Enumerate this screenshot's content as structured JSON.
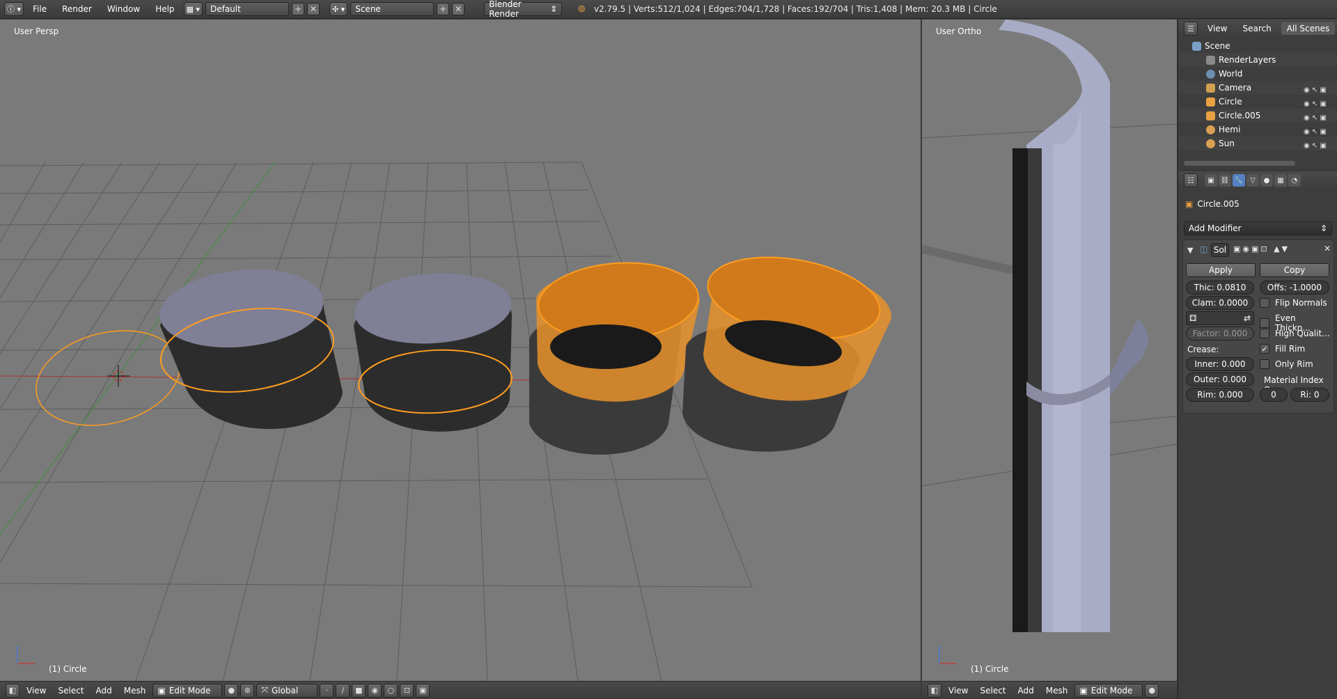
{
  "topbar": {
    "menus": [
      "File",
      "Render",
      "Window",
      "Help"
    ],
    "layout": "Default",
    "scene": "Scene",
    "engine": "Blender Render",
    "stats": "v2.79.5 | Verts:512/1,024 | Edges:704/1,728 | Faces:192/704 | Tris:1,408 | Mem: 20.3 MB | Circle"
  },
  "left_view": {
    "label": "User Persp",
    "footer": "(1) Circle",
    "header": {
      "menus": [
        "View",
        "Select",
        "Add",
        "Mesh"
      ],
      "mode": "Edit Mode",
      "orientation": "Global"
    }
  },
  "right_view": {
    "label": "User Ortho",
    "footer": "(1) Circle",
    "header": {
      "menus": [
        "View",
        "Select",
        "Add",
        "Mesh"
      ],
      "mode": "Edit Mode"
    }
  },
  "outliner": {
    "tabs": [
      "View",
      "Search",
      "All Scenes"
    ],
    "items": [
      {
        "label": "Scene",
        "icon": "scene-icon",
        "color": "#7aa0c8"
      },
      {
        "label": "RenderLayers",
        "icon": "render-layers-icon",
        "color": "#8a8a8a"
      },
      {
        "label": "World",
        "icon": "world-icon",
        "color": "#6b8fb0"
      },
      {
        "label": "Camera",
        "icon": "camera-icon",
        "color": "#d0a050"
      },
      {
        "label": "Circle",
        "icon": "mesh-icon",
        "color": "#e8a040"
      },
      {
        "label": "Circle.005",
        "icon": "mesh-icon",
        "color": "#e8a040"
      },
      {
        "label": "Hemi",
        "icon": "lamp-icon",
        "color": "#d8a050"
      },
      {
        "label": "Sun",
        "icon": "lamp-icon",
        "color": "#d8a050"
      }
    ]
  },
  "properties": {
    "object_name": "Circle.005",
    "add_modifier": "Add Modifier",
    "modifier_name": "Sol",
    "apply": "Apply",
    "copy": "Copy",
    "thickness": "Thic: 0.0810",
    "offset": "Offs: -1.0000",
    "clamp": "Clam: 0.0000",
    "factor": "Factor: 0.000",
    "crease_label": "Crease:",
    "inner": "Inner:  0.000",
    "outer": "Outer:  0.000",
    "rim": "Rim:  0.000",
    "flip_normals": "Flip Normals",
    "even_thickness": "Even Thickn...",
    "high_quality": "High Qualit...",
    "fill_rim": "Fill Rim",
    "only_rim": "Only Rim",
    "material_index": "Material Index O...",
    "mat_a": "0",
    "mat_b": "Ri:  0",
    "checks": {
      "flip_normals": false,
      "even_thickness": false,
      "high_quality": false,
      "fill_rim": true,
      "only_rim": false
    }
  },
  "colors": {
    "accent": "#5680c2",
    "selection": "#ff9d1f",
    "viewport": "#7a7a7a"
  }
}
